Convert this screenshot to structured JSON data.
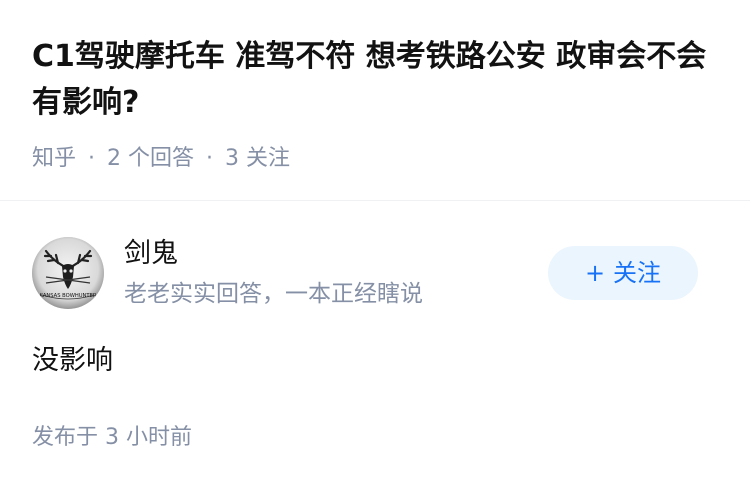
{
  "question": {
    "title": "C1驾驶摩托车 准驾不符 想考铁路公安 政审会不会有影响?",
    "source": "知乎",
    "separator": "·",
    "answer_count": "2",
    "answer_count_label": "个回答",
    "follower_count": "3",
    "follower_count_label": "关注"
  },
  "answer": {
    "author": {
      "name": "剑鬼",
      "bio": "老老实实回答，一本正经瞎说",
      "avatar_text": "KANSAS BOWHUNTER",
      "avatar_icon": "deer-skull-icon"
    },
    "follow_button": {
      "icon": "plus-icon",
      "plus": "+",
      "label": "关注"
    },
    "content": "没影响",
    "published_prefix": "发布于",
    "published_value": "3",
    "published_suffix": "小时前"
  },
  "colors": {
    "title": "#121212",
    "meta": "#8590a6",
    "accent": "#1772f6",
    "button_bg": "#ebf5fd"
  }
}
